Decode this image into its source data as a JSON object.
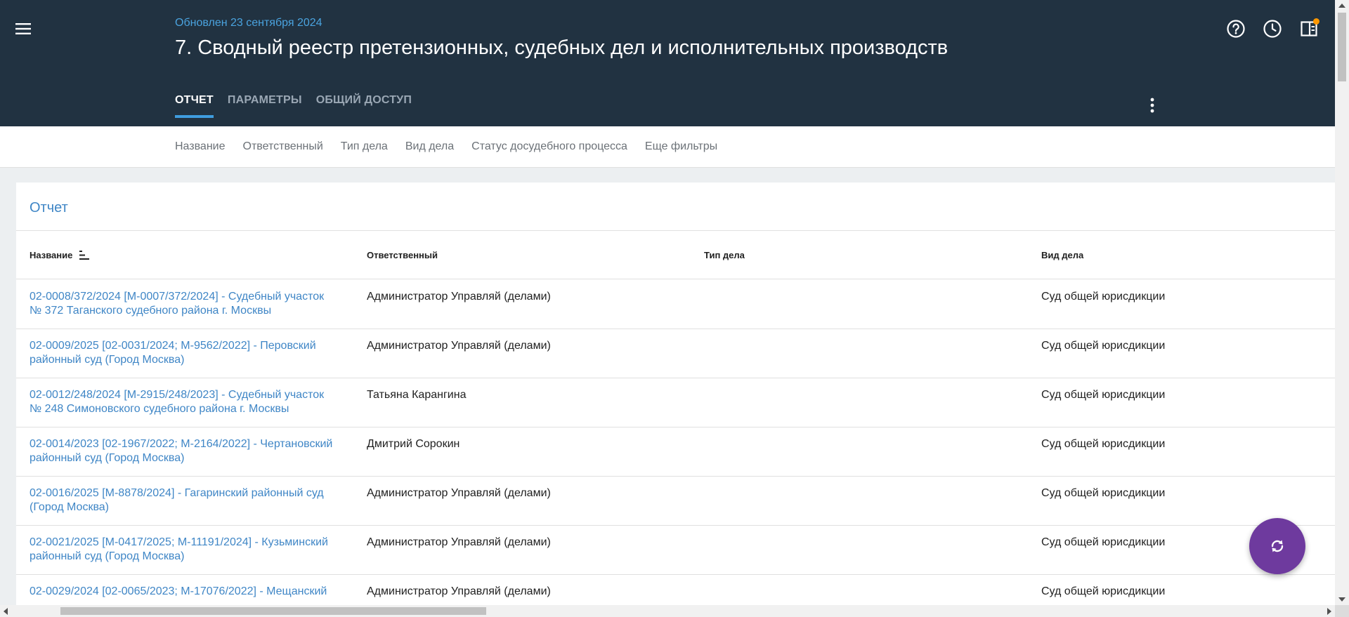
{
  "header": {
    "updated": "Обновлен 23 сентября 2024",
    "title": "7. Сводный реестр претензионных, судебных дел и исполнительных производств",
    "icons": [
      "menu-icon",
      "help-icon",
      "history-icon",
      "notifications-panel-icon",
      "more-vert-icon"
    ],
    "tabs": [
      {
        "label": "ОТЧЕТ",
        "active": true
      },
      {
        "label": "ПАРАМЕТРЫ",
        "active": false
      },
      {
        "label": "ОБЩИЙ ДОСТУП",
        "active": false
      }
    ]
  },
  "filters": [
    "Название",
    "Ответственный",
    "Тип дела",
    "Вид дела",
    "Статус досудебного процесса",
    "Еще фильтры"
  ],
  "report": {
    "title": "Отчет",
    "columns": [
      "Название",
      "Ответственный",
      "Тип дела",
      "Вид дела"
    ],
    "rows": [
      {
        "name": "02-0008/372/2024 [М-0007/372/2024] - Судебный участок № 372 Таганского судебного района г. Москвы",
        "responsible": "Администратор Управляй (делами)",
        "type": "",
        "kind": "Суд общей юрисдикции"
      },
      {
        "name": "02-0009/2025 [02-0031/2024; М-9562/2022] - Перовский районный суд (Город Москва)",
        "responsible": "Администратор Управляй (делами)",
        "type": "",
        "kind": "Суд общей юрисдикции"
      },
      {
        "name": "02-0012/248/2024 [М-2915/248/2023] - Судебный участок № 248 Симоновского судебного района г. Москвы",
        "responsible": "Татьяна Карангина",
        "type": "",
        "kind": "Суд общей юрисдикции"
      },
      {
        "name": "02-0014/2023 [02-1967/2022; М-2164/2022] - Чертановский районный суд (Город Москва)",
        "responsible": "Дмитрий Сорокин",
        "type": "",
        "kind": "Суд общей юрисдикции"
      },
      {
        "name": "02-0016/2025 [М-8878/2024] - Гагаринский районный суд (Город Москва)",
        "responsible": "Администратор Управляй (делами)",
        "type": "",
        "kind": "Суд общей юрисдикции"
      },
      {
        "name": "02-0021/2025 [М-0417/2025; М-11191/2024] - Кузьминский районный суд (Город Москва)",
        "responsible": "Администратор Управляй (делами)",
        "type": "",
        "kind": "Суд общей юрисдикции"
      },
      {
        "name": "02-0029/2024 [02-0065/2023; М-17076/2022] - Мещанский",
        "responsible": "Администратор Управляй (делами)",
        "type": "",
        "kind": "Суд общей юрисдикции"
      }
    ]
  },
  "fab": {
    "icon": "refresh-icon"
  },
  "colors": {
    "header_bg": "#213241",
    "accent": "#3f9ddf",
    "link": "#3f86c6",
    "fab": "#6e3a9e",
    "badge": "#ff9800"
  }
}
